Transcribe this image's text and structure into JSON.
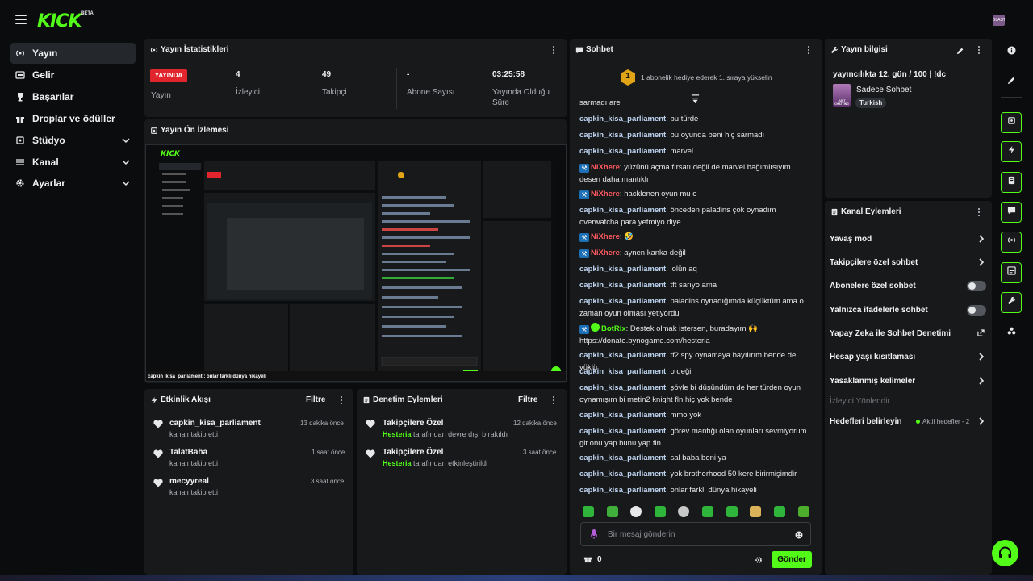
{
  "brand": {
    "logo": "KICK",
    "beta": "BETA",
    "avatar_text": "BLAST",
    "green": "#53fc18",
    "live_red": "#e1252d"
  },
  "sidebar": {
    "items": [
      {
        "label": "Yayın",
        "icon": "broadcast-icon",
        "active": true
      },
      {
        "label": "Gelir",
        "icon": "revenue-icon"
      },
      {
        "label": "Başarılar",
        "icon": "trophy-icon"
      },
      {
        "label": "Droplar ve ödüller",
        "icon": "gift-icon"
      },
      {
        "label": "Stüdyo",
        "icon": "studio-icon",
        "expandable": true
      },
      {
        "label": "Kanal",
        "icon": "channel-icon",
        "expandable": true
      },
      {
        "label": "Ayarlar",
        "icon": "gear-icon",
        "expandable": true
      }
    ]
  },
  "stats": {
    "title": "Yayın İstatistikleri",
    "live": "YAYINDA",
    "live_label": "Yayın",
    "viewers": "4",
    "viewers_label": "İzleyici",
    "followers": "49",
    "followers_label": "Takipçi",
    "subs": "-",
    "subs_label": "Abone Sayısı",
    "uptime": "03:25:58",
    "uptime_label_1": "Yayında Olduğu",
    "uptime_label_2": "Süre"
  },
  "preview": {
    "title": "Yayın Ön İzlemesi",
    "caption_user": "capkin_kisa_parliament",
    "caption_text": ": onlar farklı dünya hikayeli"
  },
  "activity": {
    "title": "Etkinlik Akışı",
    "filter": "Filtre",
    "items": [
      {
        "name": "capkin_kisa_parliament",
        "sub": "kanalı takip etti",
        "time": "13 dakika önce"
      },
      {
        "name": "TalatBaha",
        "sub": "kanalı takip etti",
        "time": "1 saat önce"
      },
      {
        "name": "mecyyreal",
        "sub": "kanalı takip etti",
        "time": "3 saat önce"
      }
    ]
  },
  "moderation": {
    "title": "Denetim Eylemleri",
    "filter": "Filtre",
    "items": [
      {
        "name": "Takipçilere Özel",
        "actor": "Hesteria",
        "sub": "tarafından devre dışı bırakıldı",
        "time": "12 dakika önce"
      },
      {
        "name": "Takipçilere Özel",
        "actor": "Hesteria",
        "sub": "tarafından etkinleştirildi",
        "time": "3 saat önce"
      }
    ]
  },
  "chat": {
    "title": "Sohbet",
    "banner": "1 abonelik hediye ederek 1. sıraya yükselin",
    "banner_rank": "1",
    "cut_text": "sarmadı are",
    "messages": [
      {
        "user": "capkin_kisa_parliament",
        "text": "bu türde"
      },
      {
        "user": "capkin_kisa_parliament",
        "text": "bu oyunda beni hiç sarmadı"
      },
      {
        "user": "capkin_kisa_parliament",
        "text": "marvel"
      },
      {
        "user": "NiXhere",
        "text": "yüzünü açma fırsatı değil de marvel bağımlısıyım desen daha mantıklı",
        "style": "red"
      },
      {
        "user": "NiXhere",
        "text": "hacklenen oyun mu o",
        "style": "red"
      },
      {
        "user": "capkin_kisa_parliament",
        "text": "önceden paladins çok oynadım overwatcha para yetmiyo diye"
      },
      {
        "user": "NiXhere",
        "text": "🤣",
        "style": "red"
      },
      {
        "user": "NiXhere",
        "text": "aynen kanka değil",
        "style": "red"
      },
      {
        "user": "capkin_kisa_parliament",
        "text": "lolün aq"
      },
      {
        "user": "capkin_kisa_parliament",
        "text": "tft sarıyo ama"
      },
      {
        "user": "capkin_kisa_parliament",
        "text": "paladins oynadığımda küçüktüm ama o zaman oyun olması yetiyordu"
      },
      {
        "user": "BotRix",
        "text": "Destek olmak istersen, buradayım 🙌 https://donate.bynogame.com/hesteria",
        "style": "green"
      },
      {
        "user": "capkin_kisa_parliament",
        "text": "tf2 spy oynamaya bayılırım bende de yüklü"
      },
      {
        "user": "capkin_kisa_parliament",
        "text": "o değil"
      },
      {
        "user": "capkin_kisa_parliament",
        "text": "şöyle bi düşündüm de her türden oyun oynamışım bi metin2 knight fln hiç yok bende"
      },
      {
        "user": "capkin_kisa_parliament",
        "text": "mmo yok"
      },
      {
        "user": "capkin_kisa_parliament",
        "text": "görev mantığı olan oyunları sevmiyorum git onu yap bunu yap fln"
      },
      {
        "user": "capkin_kisa_parliament",
        "text": "sal baba beni ya"
      },
      {
        "user": "capkin_kisa_parliament",
        "text": "yok brotherhood 50 kere birirmişimdir"
      },
      {
        "user": "capkin_kisa_parliament",
        "text": "onlar farklı dünya hikayeli"
      }
    ],
    "input_placeholder": "Bir mesaj gönderin",
    "points": "0",
    "send": "Gönder"
  },
  "stream_info": {
    "title": "Yayın bilgisi",
    "stream_title": "yayıncılıkta 12. gün / 100 | !dc",
    "category": "Sadece Sohbet",
    "tag": "Turkish",
    "thumb_text": "JUST CHATTING"
  },
  "channel_actions": {
    "title": "Kanal Eylemleri",
    "items": [
      {
        "label": "Yavaş mod",
        "control": "chevron"
      },
      {
        "label": "Takipçilere özel sohbet",
        "control": "chevron"
      },
      {
        "label": "Abonelere özel sohbet",
        "control": "toggle"
      },
      {
        "label": "Yalnızca ifadelerle sohbet",
        "control": "toggle"
      },
      {
        "label": "Yapay Zeka ile Sohbet Denetimi",
        "control": "external"
      },
      {
        "label": "Hesap yaşı kısıtlaması",
        "control": "chevron"
      },
      {
        "label": "Yasaklanmış kelimeler",
        "control": "chevron"
      },
      {
        "label": "İzleyici Yönlendir",
        "control": "none",
        "disabled": true
      },
      {
        "label": "Hedefleri belirleyin",
        "control": "chevron",
        "badge": "Aktif hedefler - 2"
      }
    ]
  },
  "rail": {
    "icons": [
      "info-icon",
      "pencil-icon",
      "preview-icon",
      "lightning-icon",
      "document-icon",
      "chat-icon",
      "broadcast-icon",
      "moderation-icon",
      "wrench-icon",
      "nodes-icon"
    ]
  }
}
